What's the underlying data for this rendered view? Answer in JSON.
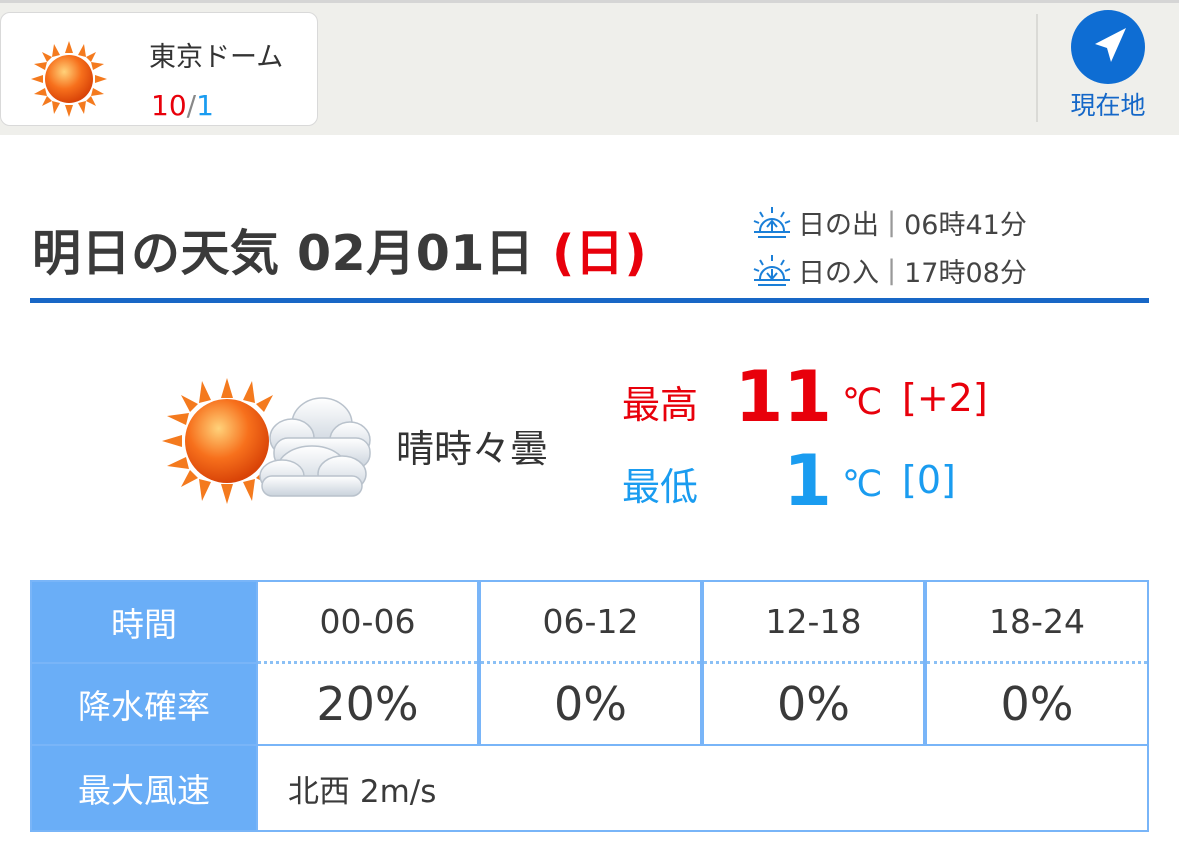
{
  "location": {
    "name": "東京ドーム",
    "high": "10",
    "separator": "/",
    "low": "1",
    "icon": "sun-icon"
  },
  "current_location_button": {
    "label": "現在地",
    "icon": "navigation-arrow-icon"
  },
  "forecast": {
    "title": "明日の天気 02月01日",
    "day_of_week": "(日)",
    "sunrise_label": "日の出",
    "sunrise_time": "06時41分",
    "sunset_label": "日の入",
    "sunset_time": "17時08分",
    "condition_icon": "sunny-with-clouds-icon",
    "condition": "晴時々曇",
    "high_label": "最高",
    "high_value": "11",
    "high_unit": "℃",
    "high_diff": "[+2]",
    "low_label": "最低",
    "low_value": "1",
    "low_unit": "℃",
    "low_diff": "[0]"
  },
  "table": {
    "time_header": "時間",
    "rain_header": "降水確率",
    "wind_header": "最大風速",
    "times": [
      "00-06",
      "06-12",
      "12-18",
      "18-24"
    ],
    "rain": [
      "20%",
      "0%",
      "0%",
      "0%"
    ],
    "wind": "北西 2m/s"
  },
  "colors": {
    "high": "#e8000b",
    "low": "#1a9cf0",
    "accent": "#1867c6",
    "table_header": "#6aaef7"
  }
}
